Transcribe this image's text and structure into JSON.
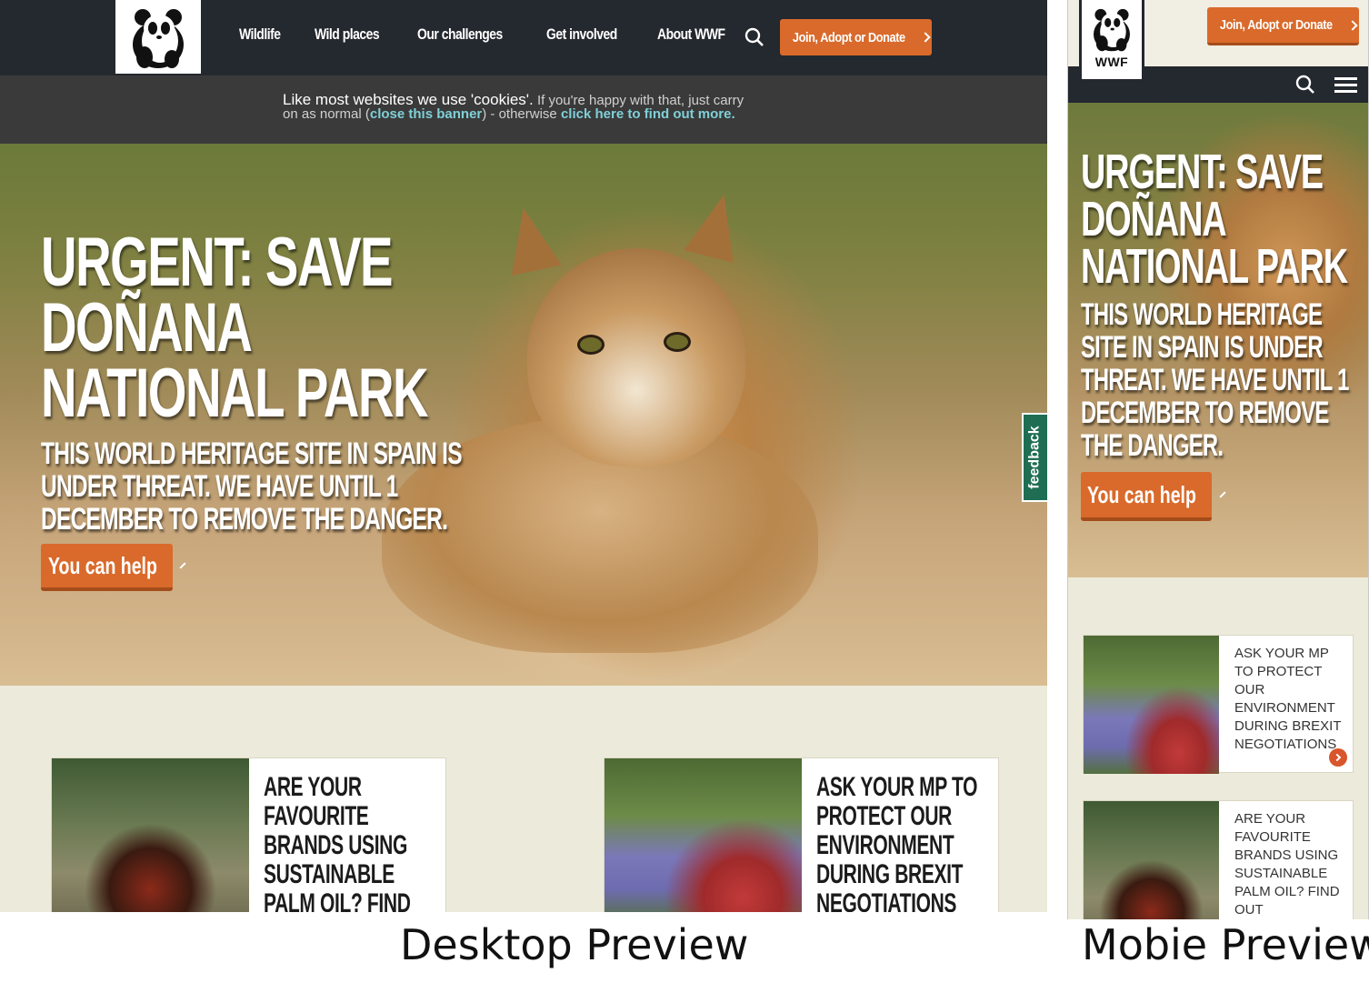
{
  "brand": {
    "logo_text": "WWF",
    "accent": "#d96a2b",
    "nav_bg": "#24282f",
    "page_bg": "#ecebdb"
  },
  "desktop": {
    "nav": {
      "items": [
        "Wildlife",
        "Wild places",
        "Our challenges",
        "Get involved",
        "About WWF"
      ],
      "join_label": "Join, Adopt or Donate"
    },
    "cookie": {
      "lead": "Like most websites we use 'cookies'.",
      "text1": " If you're happy with that, just carry on as normal (",
      "close_link": "close this banner",
      "text2": ") - otherwise ",
      "more_link": "click here to find out more",
      "text3": "."
    },
    "hero": {
      "title": "URGENT: SAVE DOÑANA NATIONAL PARK",
      "subtitle": "THIS WORLD HERITAGE SITE IN SPAIN IS UNDER THREAT. WE HAVE UNTIL 1 DECEMBER TO REMOVE THE DANGER.",
      "cta": "You can help"
    },
    "feedback": "feedback",
    "cards": [
      {
        "text": "ARE YOUR FAVOURITE BRANDS USING SUSTAINABLE PALM OIL? FIND OUT"
      },
      {
        "text": "ASK YOUR MP TO PROTECT OUR ENVIRONMENT DURING BREXIT NEGOTIATIONS"
      }
    ],
    "caption": "Desktop Preview"
  },
  "mobile": {
    "join_label": "Join, Adopt or Donate",
    "hero": {
      "title": "URGENT: SAVE DOÑANA NATIONAL PARK",
      "subtitle": "THIS WORLD HERITAGE SITE IN SPAIN IS UNDER THREAT. WE HAVE UNTIL 1 DECEMBER TO REMOVE THE DANGER.",
      "cta": "You can help"
    },
    "cards": [
      {
        "text": "ASK YOUR MP TO PROTECT OUR ENVIRONMENT DURING BREXIT NEGOTIATIONS"
      },
      {
        "text": "ARE YOUR FAVOURITE BRANDS USING SUSTAINABLE PALM OIL? FIND OUT"
      }
    ],
    "caption": "Mobie Preview"
  }
}
